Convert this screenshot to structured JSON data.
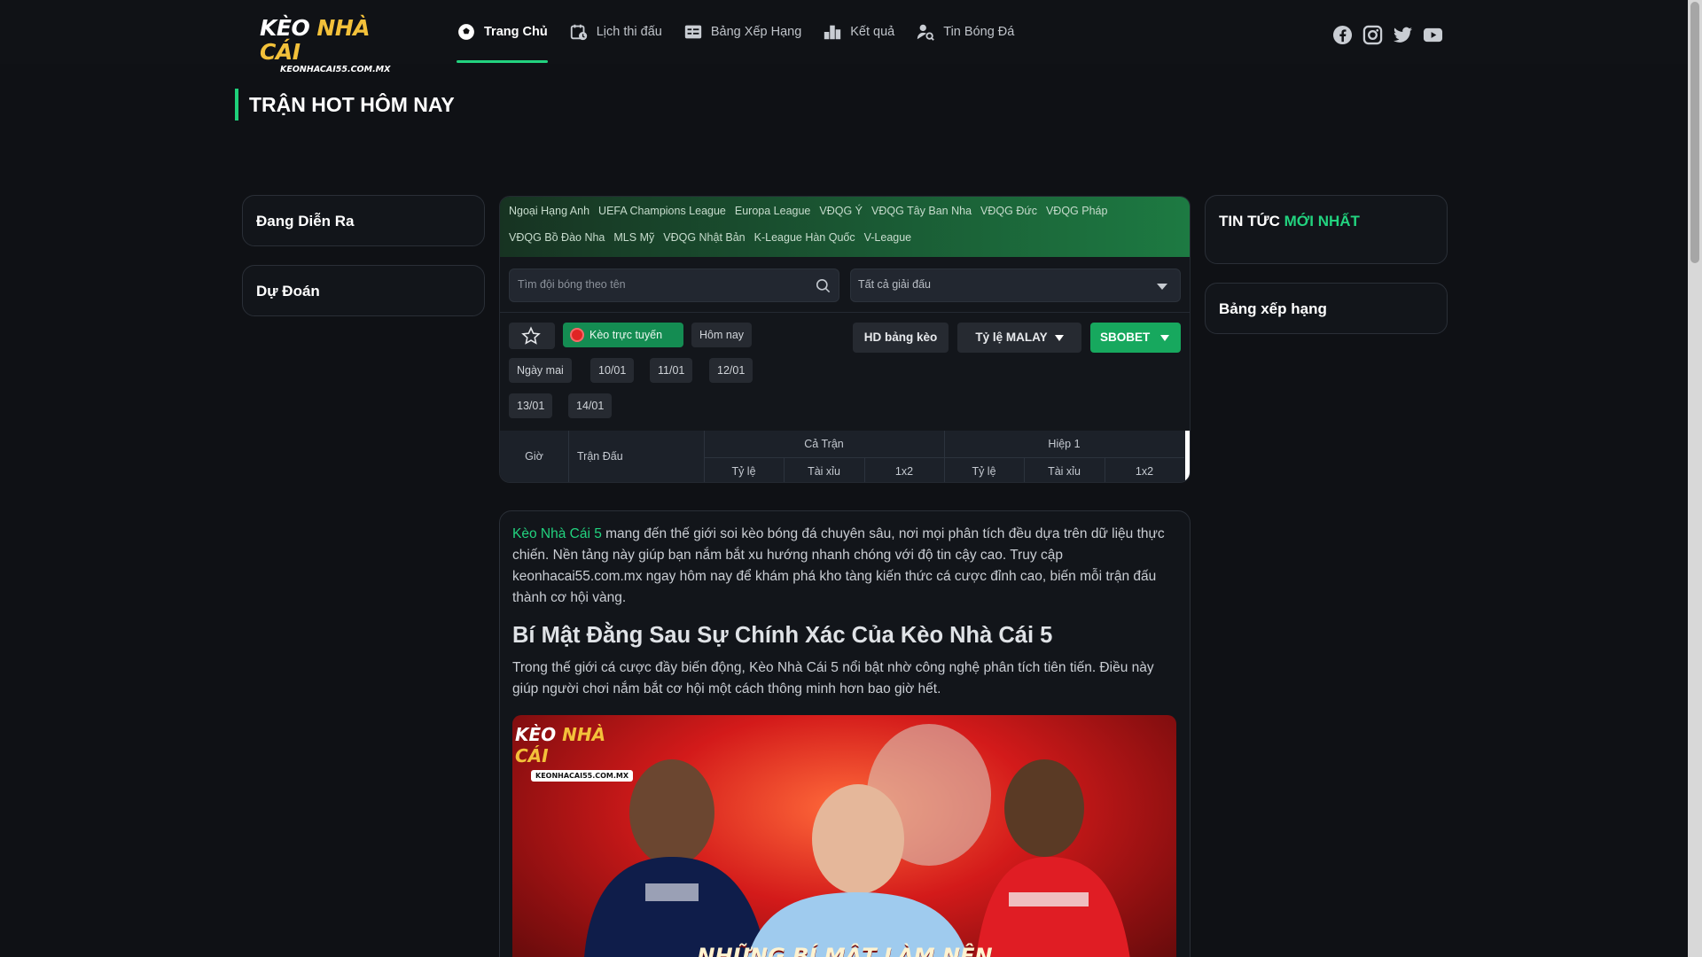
{
  "header": {
    "logo": {
      "line1_a": "KÈO ",
      "line1_b": "NHÀ CÁI",
      "line2": "KEONHACAI55.COM.MX"
    },
    "nav": [
      {
        "label": "Trang Chủ",
        "icon": "soccer-ball-icon",
        "active": true
      },
      {
        "label": "Lịch thi đấu",
        "icon": "calendar-icon"
      },
      {
        "label": "Bảng Xếp Hạng",
        "icon": "ranking-board-icon"
      },
      {
        "label": "Kết quả",
        "icon": "bar-chart-icon"
      },
      {
        "label": "Tin Bóng Đá",
        "icon": "user-search-icon"
      }
    ],
    "socials": [
      "facebook-icon",
      "instagram-icon",
      "twitter-icon",
      "youtube-icon"
    ]
  },
  "hot_title": "TRẬN HOT HÔM NAY",
  "left": {
    "live": "Đang Diễn Ra",
    "predict": "Dự Đoán"
  },
  "right": {
    "news_a": "TIN TỨC ",
    "news_b": "MỚI NHẤT",
    "standings": "Bảng xếp hạng"
  },
  "odds": {
    "leagues": [
      "Ngoại Hạng Anh",
      "UEFA Champions League",
      "Europa League",
      "VĐQG Ý",
      "VĐQG Tây Ban Nha",
      "VĐQG Đức",
      "VĐQG Pháp",
      "VĐQG Bồ Đào Nha",
      "MLS Mỹ",
      "VĐQG Nhật Bản",
      "K-League Hàn Quốc",
      "V-League"
    ],
    "search_placeholder": "Tìm đội bóng theo tên",
    "select_value": "Tất cả giải đấu",
    "live_label": "Kèo trực tuyến",
    "today": "Hôm nay",
    "dates": [
      "Ngày mai",
      "10/01",
      "11/01",
      "12/01",
      "13/01",
      "14/01"
    ],
    "guide": "HD bảng kèo",
    "odds_type": "Tỷ lệ MALAY",
    "bookmaker": "SBOBET",
    "table": {
      "time": "Giờ",
      "match": "Trận Đấu",
      "full": "Cả Trận",
      "half": "Hiệp 1",
      "sub": [
        "Tỷ lệ",
        "Tài xỉu",
        "1x2",
        "Tỷ lệ",
        "Tài xỉu",
        "1x2"
      ]
    }
  },
  "article": {
    "p1_link": "Kèo Nhà Cái 5",
    "p1_rest": " mang đến thế giới soi kèo bóng đá chuyên sâu, nơi mọi phân tích đều dựa trên dữ liệu thực chiến. Nền tảng này giúp bạn nắm bắt xu hướng nhanh chóng với độ tin cậy cao. Truy cập keonhacai55.com.mx ngay hôm nay để khám phá kho tàng kiến thức cá cược đỉnh cao, biến mỗi trận đấu thành cơ hội vàng.",
    "h2": "Bí Mật Đằng Sau Sự Chính Xác Của Kèo Nhà Cái 5",
    "p2": "Trong thế giới cá cược đầy biến động, Kèo Nhà Cái 5 nổi bật nhờ công nghệ phân tích tiên tiến. Điều này giúp người chơi nắm bắt cơ hội một cách thông minh hơn bao giờ hết.",
    "banner": {
      "logo_a": "KÈO ",
      "logo_b": "NHÀ CÁI",
      "logo_url": "KEONHACAI55.COM.MX",
      "caption": "NHỮNG BÍ MẬT LÀM NÊN"
    }
  },
  "colors": {
    "accent": "#22d37f",
    "bg": "#0f1115",
    "live": "#148c52",
    "button": "#17a85e"
  }
}
